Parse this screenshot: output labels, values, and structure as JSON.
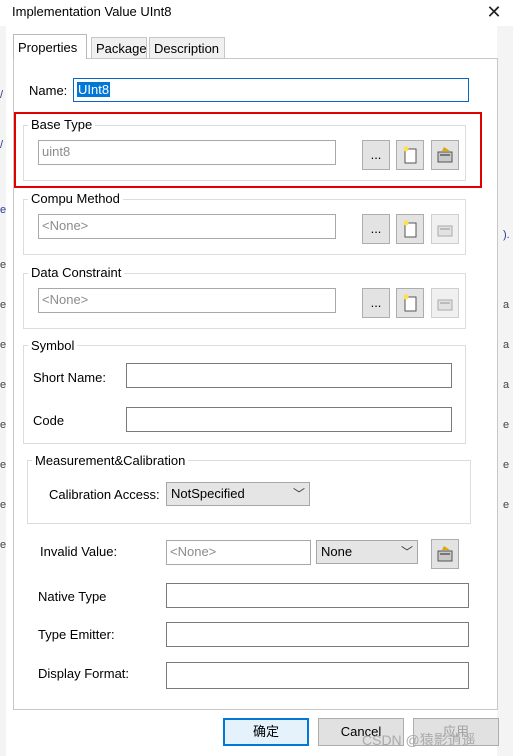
{
  "window": {
    "title": "Implementation Value UInt8",
    "close_glyph": "✕"
  },
  "tabs": [
    {
      "label": "Properties",
      "active": true
    },
    {
      "label": "Package",
      "active": false
    },
    {
      "label": "Description",
      "active": false
    }
  ],
  "name": {
    "label": "Name:",
    "value": "UInt8"
  },
  "base_type": {
    "title": "Base Type",
    "value": "uint8",
    "browse_label": "..."
  },
  "compu_method": {
    "title": "Compu Method",
    "value": "<None>",
    "browse_label": "..."
  },
  "data_constraint": {
    "title": "Data Constraint",
    "value": "<None>",
    "browse_label": "..."
  },
  "symbol": {
    "title": "Symbol",
    "short_name_label": "Short Name:",
    "short_name_value": "",
    "code_label": "Code",
    "code_value": ""
  },
  "measurement": {
    "title": "Measurement&Calibration",
    "calibration_label": "Calibration Access:",
    "calibration_value": "NotSpecified"
  },
  "invalid_value": {
    "label": "Invalid Value:",
    "value": "<None>",
    "select_value": "None"
  },
  "native_type": {
    "label": "Native Type",
    "value": ""
  },
  "type_emitter": {
    "label": "Type Emitter:",
    "value": ""
  },
  "display_format": {
    "label": "Display Format:",
    "value": ""
  },
  "footer": {
    "ok_label": "确定",
    "cancel_label": "Cancel",
    "third_label": "应用"
  },
  "watermark": "CSDN @猿影逍遥",
  "colors": {
    "highlight_border": "#e00000",
    "selection": "#0078d7"
  },
  "icons": {
    "new": "new-document-icon",
    "edit": "edit-properties-icon"
  }
}
